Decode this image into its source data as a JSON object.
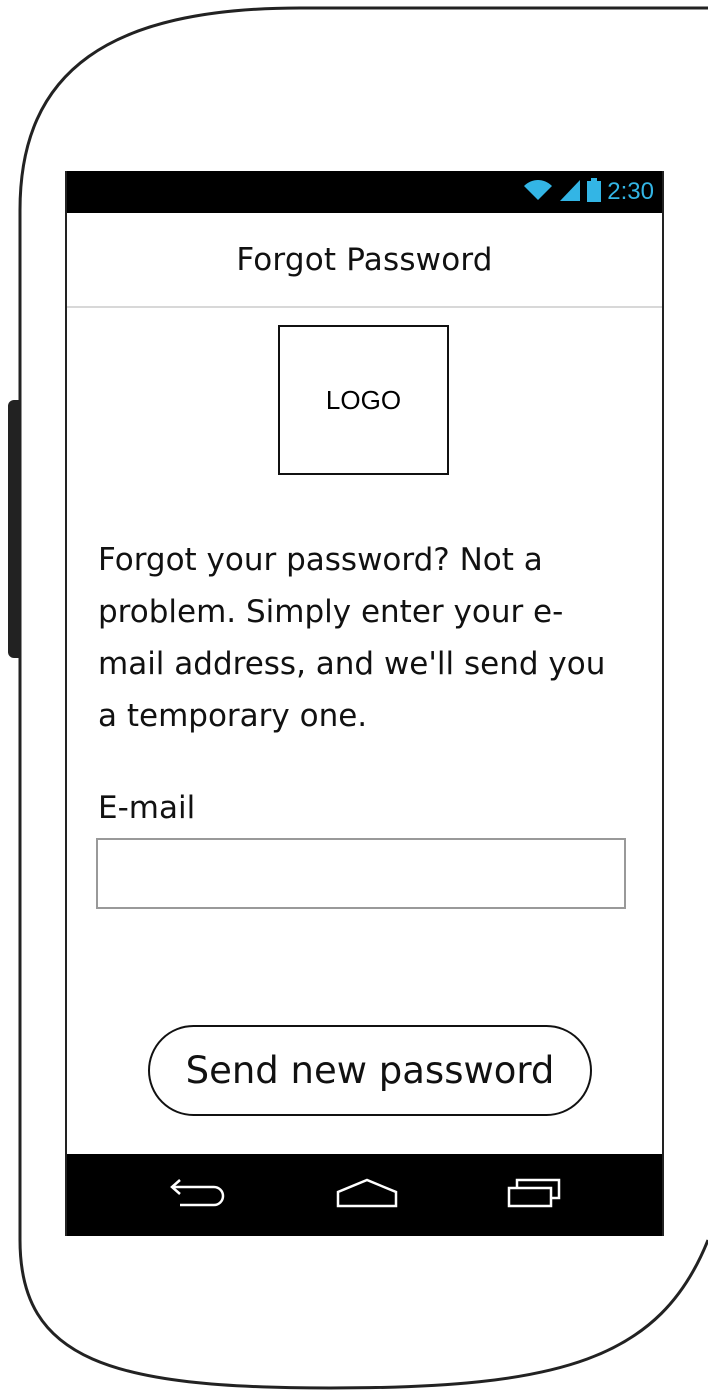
{
  "status_bar": {
    "time": "2:30",
    "time_color": "#33b5e5",
    "icons": [
      "wifi-icon",
      "signal-icon",
      "battery-icon"
    ]
  },
  "header": {
    "title": "Forgot Password"
  },
  "logo": {
    "label": "LOGO"
  },
  "main": {
    "description": "Forgot your password? Not a problem. Simply enter your e-mail address, and we'll send you a temporary one.",
    "email_label": "E-mail",
    "email_value": "",
    "submit_label": "Send new password"
  },
  "nav_bar": {
    "buttons": [
      "back-icon",
      "home-icon",
      "recent-apps-icon"
    ]
  }
}
